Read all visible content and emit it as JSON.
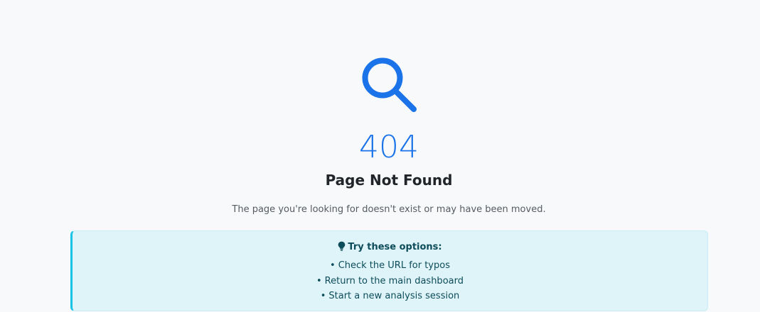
{
  "error": {
    "code": "404",
    "title": "Page Not Found",
    "message": "The page you're looking for doesn't exist or may have been moved.",
    "icon": "search-icon",
    "accent_color": "#1a73e8"
  },
  "tips": {
    "icon": "lightbulb-icon",
    "heading": "Try these options:",
    "items": [
      "Check the URL for typos",
      "Return to the main dashboard",
      "Start a new analysis session"
    ],
    "background_color": "#dff4f9",
    "border_color": "#19c3e6"
  }
}
